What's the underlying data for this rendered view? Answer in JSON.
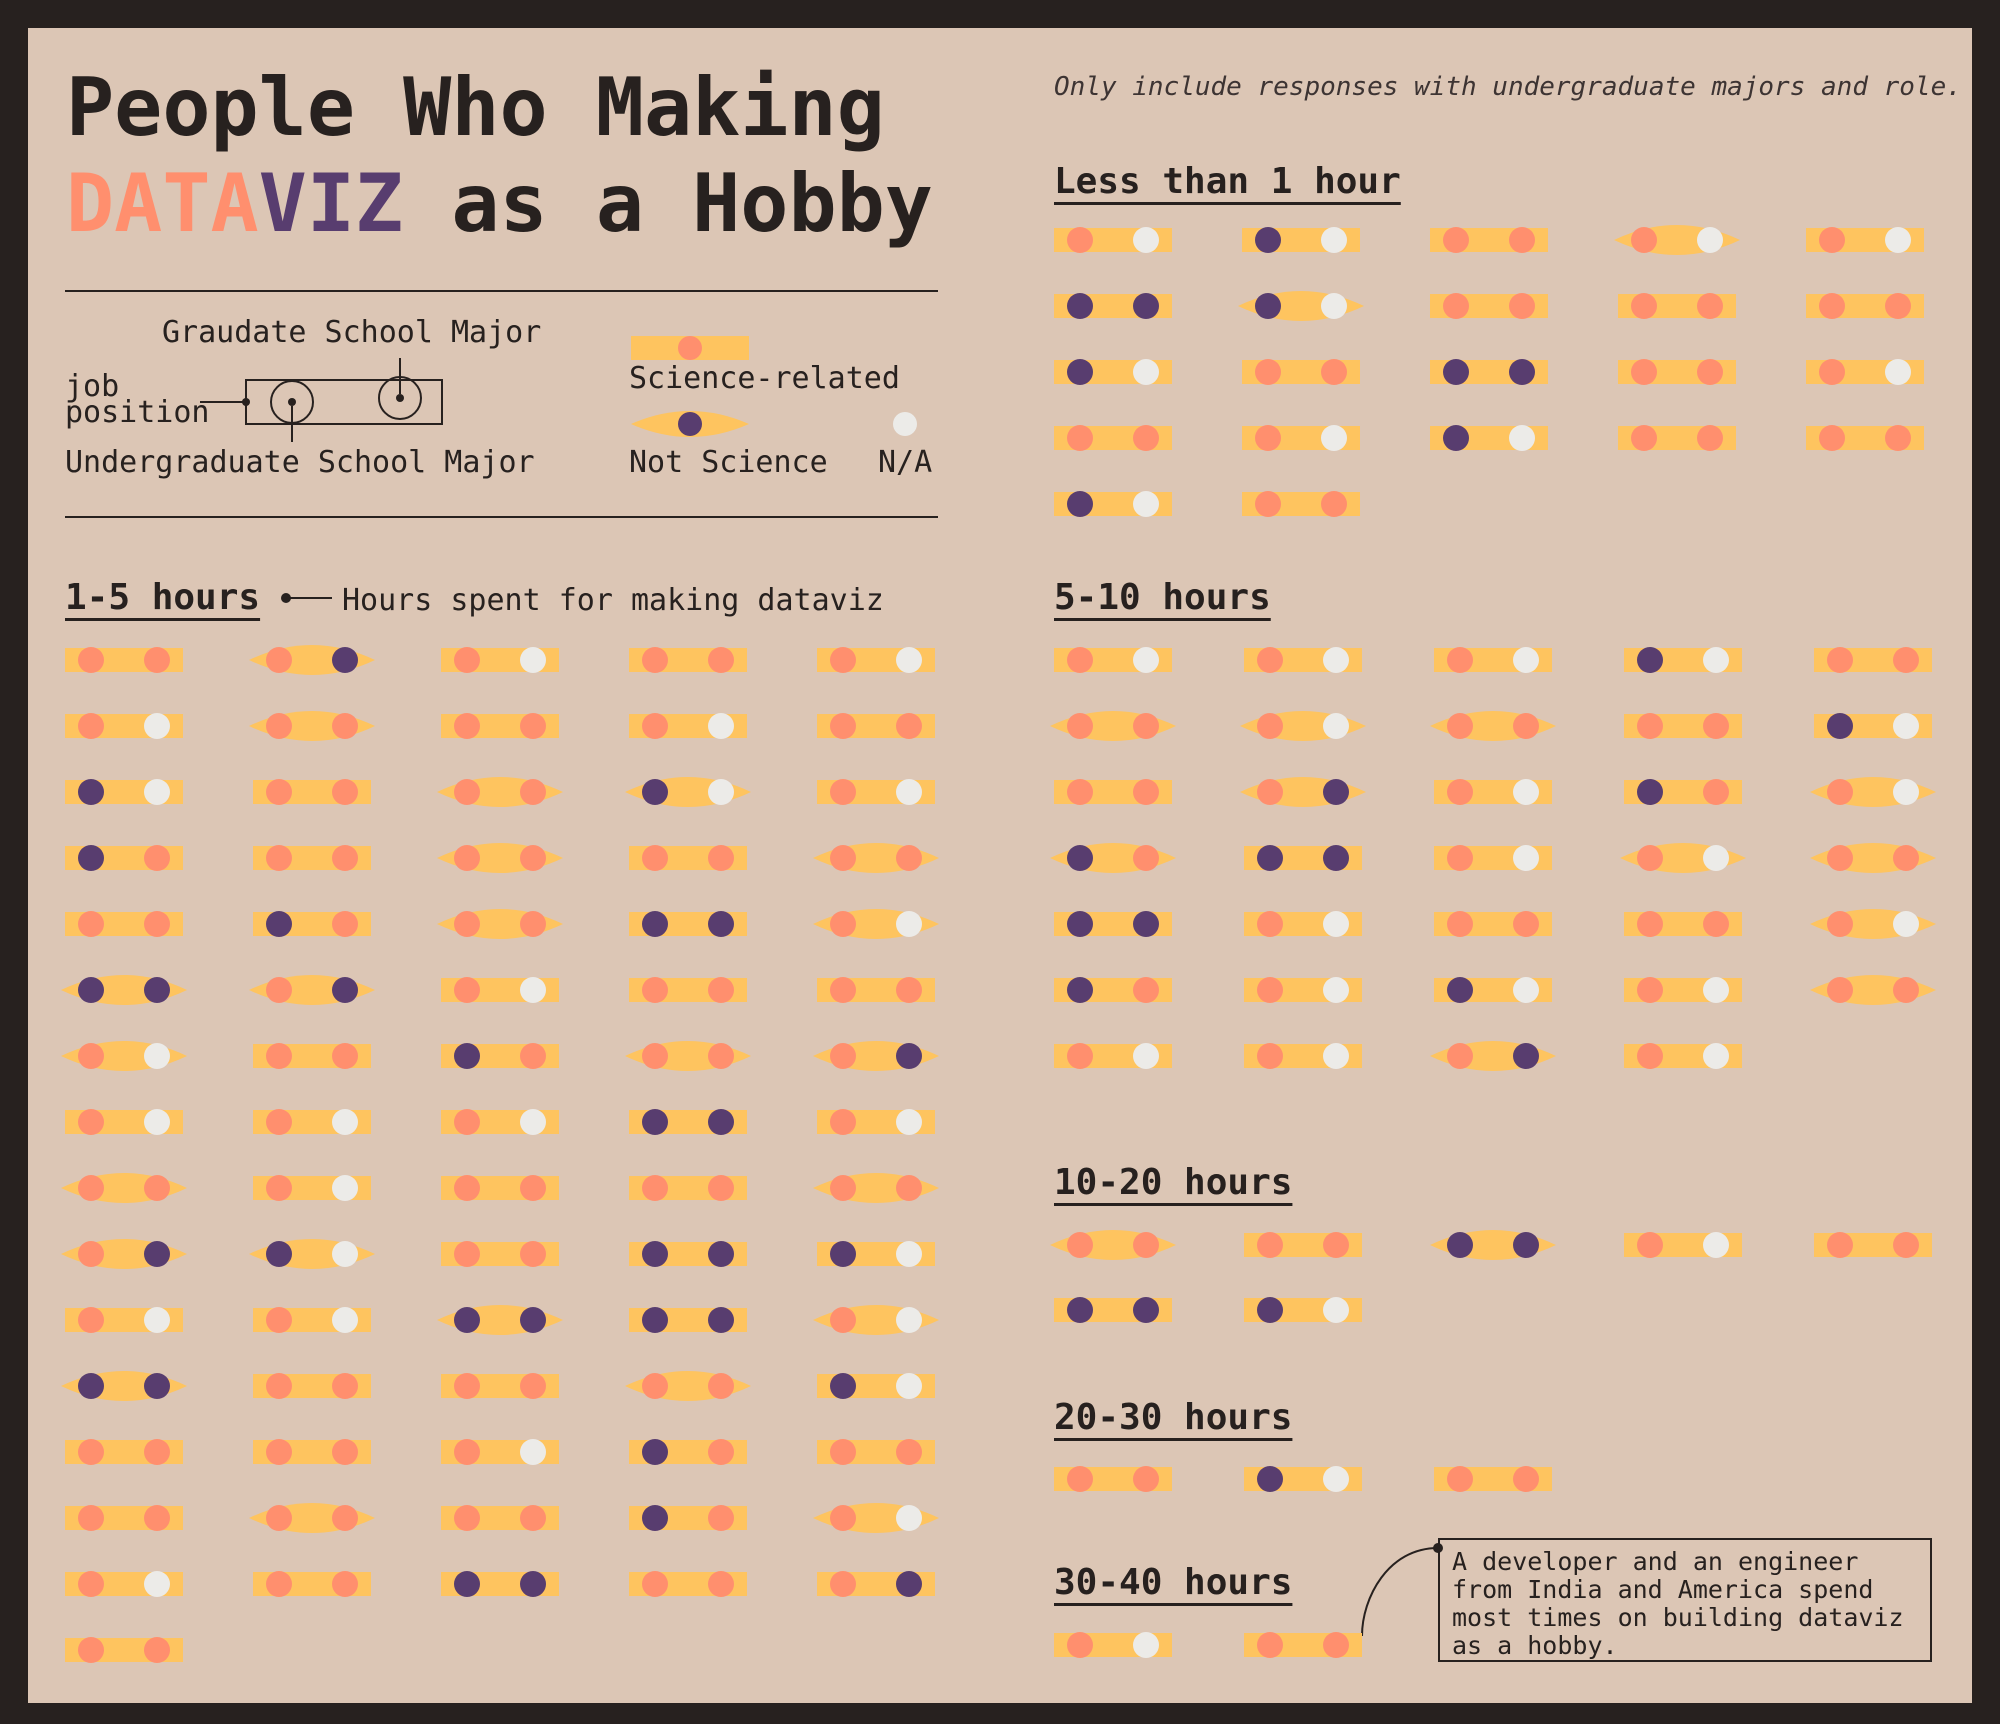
{
  "title": {
    "line1": "People Who Making",
    "highlight_a": "DATA",
    "highlight_b": "VIZ",
    "rest": " as a Hobby"
  },
  "note": "Only include responses with undergraduate majors and role.",
  "legend": {
    "graduate_label": "Graudate School Major",
    "job_label_1": "job",
    "job_label_2": "position",
    "undergrad_label": "Undergraduate School Major",
    "science_label": "Science-related",
    "not_science_label": "Not Science",
    "na_label": "N/A"
  },
  "hours_note": "Hours spent for making dataviz",
  "callout": "A developer and an engineer\nfrom India and America spend\nmost times on building dataviz\nas a hobby.",
  "colors": {
    "background": "#dcc6b5",
    "frame": "#27211f",
    "science": "#ff8f6e",
    "not_science": "#583d6f",
    "na": "#ecebe8",
    "bar": "#fec45f"
  },
  "chart_data": {
    "type": "dot-glyph",
    "encoding": {
      "bar": "job position (rectangle = science-related, pointed ellipse = not science)",
      "left_dot": "undergraduate school major",
      "right_dot": "graduate school major",
      "codes": {
        "S": "Science-related",
        "N": "Not Science",
        "X": "N/A"
      }
    },
    "groups": [
      {
        "label": "Less than 1 hour",
        "respondents": [
          [
            "S",
            "S",
            "X"
          ],
          [
            "S",
            "N",
            "X"
          ],
          [
            "S",
            "S",
            "S"
          ],
          [
            "E",
            "S",
            "X"
          ],
          [
            "S",
            "S",
            "X"
          ],
          [
            "S",
            "N",
            "N"
          ],
          [
            "E",
            "N",
            "X"
          ],
          [
            "S",
            "S",
            "S"
          ],
          [
            "S",
            "S",
            "S"
          ],
          [
            "S",
            "S",
            "S"
          ],
          [
            "S",
            "N",
            "X"
          ],
          [
            "S",
            "S",
            "S"
          ],
          [
            "S",
            "N",
            "N"
          ],
          [
            "S",
            "S",
            "S"
          ],
          [
            "S",
            "S",
            "X"
          ],
          [
            "S",
            "S",
            "S"
          ],
          [
            "S",
            "S",
            "X"
          ],
          [
            "S",
            "N",
            "X"
          ],
          [
            "S",
            "S",
            "S"
          ],
          [
            "S",
            "S",
            "S"
          ],
          [
            "S",
            "N",
            "X"
          ],
          [
            "S",
            "S",
            "S"
          ]
        ]
      },
      {
        "label": "1-5 hours",
        "respondents": [
          [
            "S",
            "S",
            "S"
          ],
          [
            "E",
            "S",
            "N"
          ],
          [
            "S",
            "S",
            "X"
          ],
          [
            "S",
            "S",
            "S"
          ],
          [
            "S",
            "S",
            "X"
          ],
          [
            "S",
            "S",
            "X"
          ],
          [
            "E",
            "S",
            "S"
          ],
          [
            "S",
            "S",
            "S"
          ],
          [
            "S",
            "S",
            "X"
          ],
          [
            "S",
            "S",
            "S"
          ],
          [
            "S",
            "N",
            "X"
          ],
          [
            "S",
            "S",
            "S"
          ],
          [
            "E",
            "S",
            "S"
          ],
          [
            "E",
            "N",
            "X"
          ],
          [
            "S",
            "S",
            "X"
          ],
          [
            "S",
            "N",
            "S"
          ],
          [
            "S",
            "S",
            "S"
          ],
          [
            "E",
            "S",
            "S"
          ],
          [
            "S",
            "S",
            "S"
          ],
          [
            "E",
            "S",
            "S"
          ],
          [
            "S",
            "S",
            "S"
          ],
          [
            "S",
            "N",
            "S"
          ],
          [
            "E",
            "S",
            "S"
          ],
          [
            "S",
            "N",
            "N"
          ],
          [
            "E",
            "S",
            "X"
          ],
          [
            "E",
            "N",
            "N"
          ],
          [
            "E",
            "S",
            "N"
          ],
          [
            "S",
            "S",
            "X"
          ],
          [
            "S",
            "S",
            "S"
          ],
          [
            "S",
            "S",
            "S"
          ],
          [
            "E",
            "S",
            "X"
          ],
          [
            "S",
            "S",
            "S"
          ],
          [
            "S",
            "N",
            "S"
          ],
          [
            "E",
            "S",
            "S"
          ],
          [
            "E",
            "S",
            "N"
          ],
          [
            "S",
            "S",
            "X"
          ],
          [
            "S",
            "S",
            "X"
          ],
          [
            "S",
            "S",
            "X"
          ],
          [
            "S",
            "N",
            "N"
          ],
          [
            "S",
            "S",
            "X"
          ],
          [
            "E",
            "S",
            "S"
          ],
          [
            "S",
            "S",
            "X"
          ],
          [
            "S",
            "S",
            "S"
          ],
          [
            "S",
            "S",
            "S"
          ],
          [
            "E",
            "S",
            "S"
          ],
          [
            "E",
            "S",
            "N"
          ],
          [
            "E",
            "N",
            "X"
          ],
          [
            "S",
            "S",
            "S"
          ],
          [
            "S",
            "N",
            "N"
          ],
          [
            "S",
            "N",
            "X"
          ],
          [
            "S",
            "S",
            "X"
          ],
          [
            "S",
            "S",
            "X"
          ],
          [
            "E",
            "N",
            "N"
          ],
          [
            "S",
            "N",
            "N"
          ],
          [
            "E",
            "S",
            "X"
          ],
          [
            "E",
            "N",
            "N"
          ],
          [
            "S",
            "S",
            "S"
          ],
          [
            "S",
            "S",
            "S"
          ],
          [
            "E",
            "S",
            "S"
          ],
          [
            "S",
            "N",
            "X"
          ],
          [
            "S",
            "S",
            "S"
          ],
          [
            "S",
            "S",
            "S"
          ],
          [
            "S",
            "S",
            "X"
          ],
          [
            "S",
            "N",
            "S"
          ],
          [
            "S",
            "S",
            "S"
          ],
          [
            "S",
            "S",
            "S"
          ],
          [
            "E",
            "S",
            "S"
          ],
          [
            "S",
            "S",
            "S"
          ],
          [
            "S",
            "N",
            "S"
          ],
          [
            "E",
            "S",
            "X"
          ],
          [
            "S",
            "S",
            "X"
          ],
          [
            "S",
            "S",
            "S"
          ],
          [
            "S",
            "N",
            "N"
          ],
          [
            "S",
            "S",
            "S"
          ],
          [
            "S",
            "S",
            "N"
          ],
          [
            "S",
            "S",
            "S"
          ]
        ]
      },
      {
        "label": "5-10 hours",
        "respondents": [
          [
            "S",
            "S",
            "X"
          ],
          [
            "S",
            "S",
            "X"
          ],
          [
            "S",
            "S",
            "X"
          ],
          [
            "S",
            "N",
            "X"
          ],
          [
            "S",
            "S",
            "S"
          ],
          [
            "E",
            "S",
            "S"
          ],
          [
            "E",
            "S",
            "X"
          ],
          [
            "E",
            "S",
            "S"
          ],
          [
            "S",
            "S",
            "S"
          ],
          [
            "S",
            "N",
            "X"
          ],
          [
            "S",
            "S",
            "S"
          ],
          [
            "E",
            "S",
            "N"
          ],
          [
            "S",
            "S",
            "X"
          ],
          [
            "S",
            "N",
            "S"
          ],
          [
            "E",
            "S",
            "X"
          ],
          [
            "E",
            "N",
            "S"
          ],
          [
            "S",
            "N",
            "N"
          ],
          [
            "S",
            "S",
            "X"
          ],
          [
            "E",
            "S",
            "X"
          ],
          [
            "E",
            "S",
            "S"
          ],
          [
            "S",
            "N",
            "N"
          ],
          [
            "S",
            "S",
            "X"
          ],
          [
            "S",
            "S",
            "S"
          ],
          [
            "S",
            "S",
            "S"
          ],
          [
            "E",
            "S",
            "X"
          ],
          [
            "S",
            "N",
            "S"
          ],
          [
            "S",
            "S",
            "X"
          ],
          [
            "S",
            "N",
            "X"
          ],
          [
            "S",
            "S",
            "X"
          ],
          [
            "E",
            "S",
            "S"
          ],
          [
            "S",
            "S",
            "X"
          ],
          [
            "S",
            "S",
            "X"
          ],
          [
            "E",
            "S",
            "N"
          ],
          [
            "S",
            "S",
            "X"
          ]
        ]
      },
      {
        "label": "10-20 hours",
        "respondents": [
          [
            "E",
            "S",
            "S"
          ],
          [
            "S",
            "S",
            "S"
          ],
          [
            "E",
            "N",
            "N"
          ],
          [
            "S",
            "S",
            "X"
          ],
          [
            "S",
            "S",
            "S"
          ],
          [
            "S",
            "N",
            "N"
          ],
          [
            "S",
            "N",
            "X"
          ]
        ]
      },
      {
        "label": "20-30 hours",
        "respondents": [
          [
            "S",
            "S",
            "S"
          ],
          [
            "S",
            "N",
            "X"
          ],
          [
            "S",
            "S",
            "S"
          ]
        ]
      },
      {
        "label": "30-40 hours",
        "respondents": [
          [
            "S",
            "S",
            "X"
          ],
          [
            "S",
            "S",
            "S"
          ]
        ]
      }
    ]
  }
}
